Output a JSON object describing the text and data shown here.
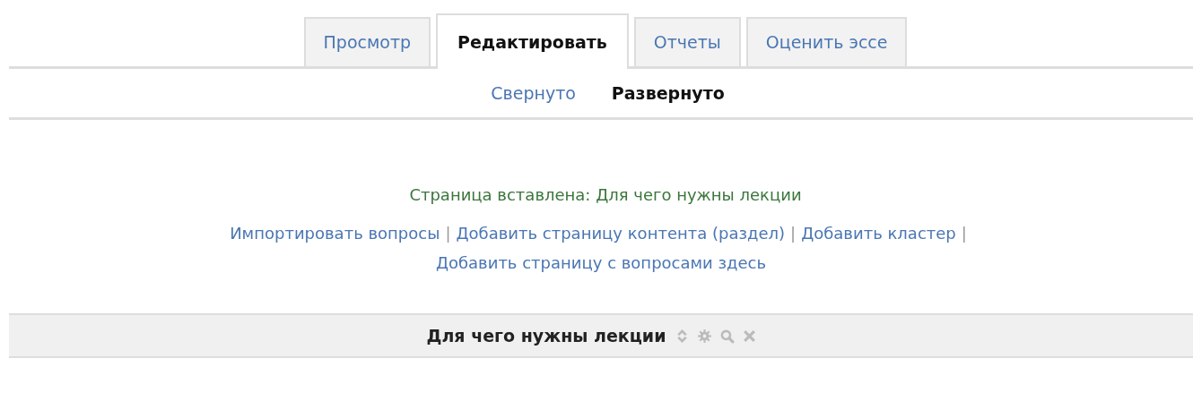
{
  "tabs": [
    {
      "label": "Просмотр",
      "selected": false
    },
    {
      "label": "Редактировать",
      "selected": true
    },
    {
      "label": "Отчеты",
      "selected": false
    },
    {
      "label": "Оценить эссе",
      "selected": false
    }
  ],
  "subtabs": [
    {
      "label": "Свернуто",
      "selected": false
    },
    {
      "label": "Развернуто",
      "selected": true
    }
  ],
  "message": "Страница вставлена: Для чего нужны лекции",
  "separator": "|",
  "actions": [
    {
      "label": "Импортировать вопросы"
    },
    {
      "label": "Добавить страницу контента (раздел)"
    },
    {
      "label": "Добавить кластер"
    },
    {
      "label": "Добавить страницу с вопросами здесь"
    }
  ],
  "page_header": {
    "title": "Для чего нужны лекции"
  }
}
